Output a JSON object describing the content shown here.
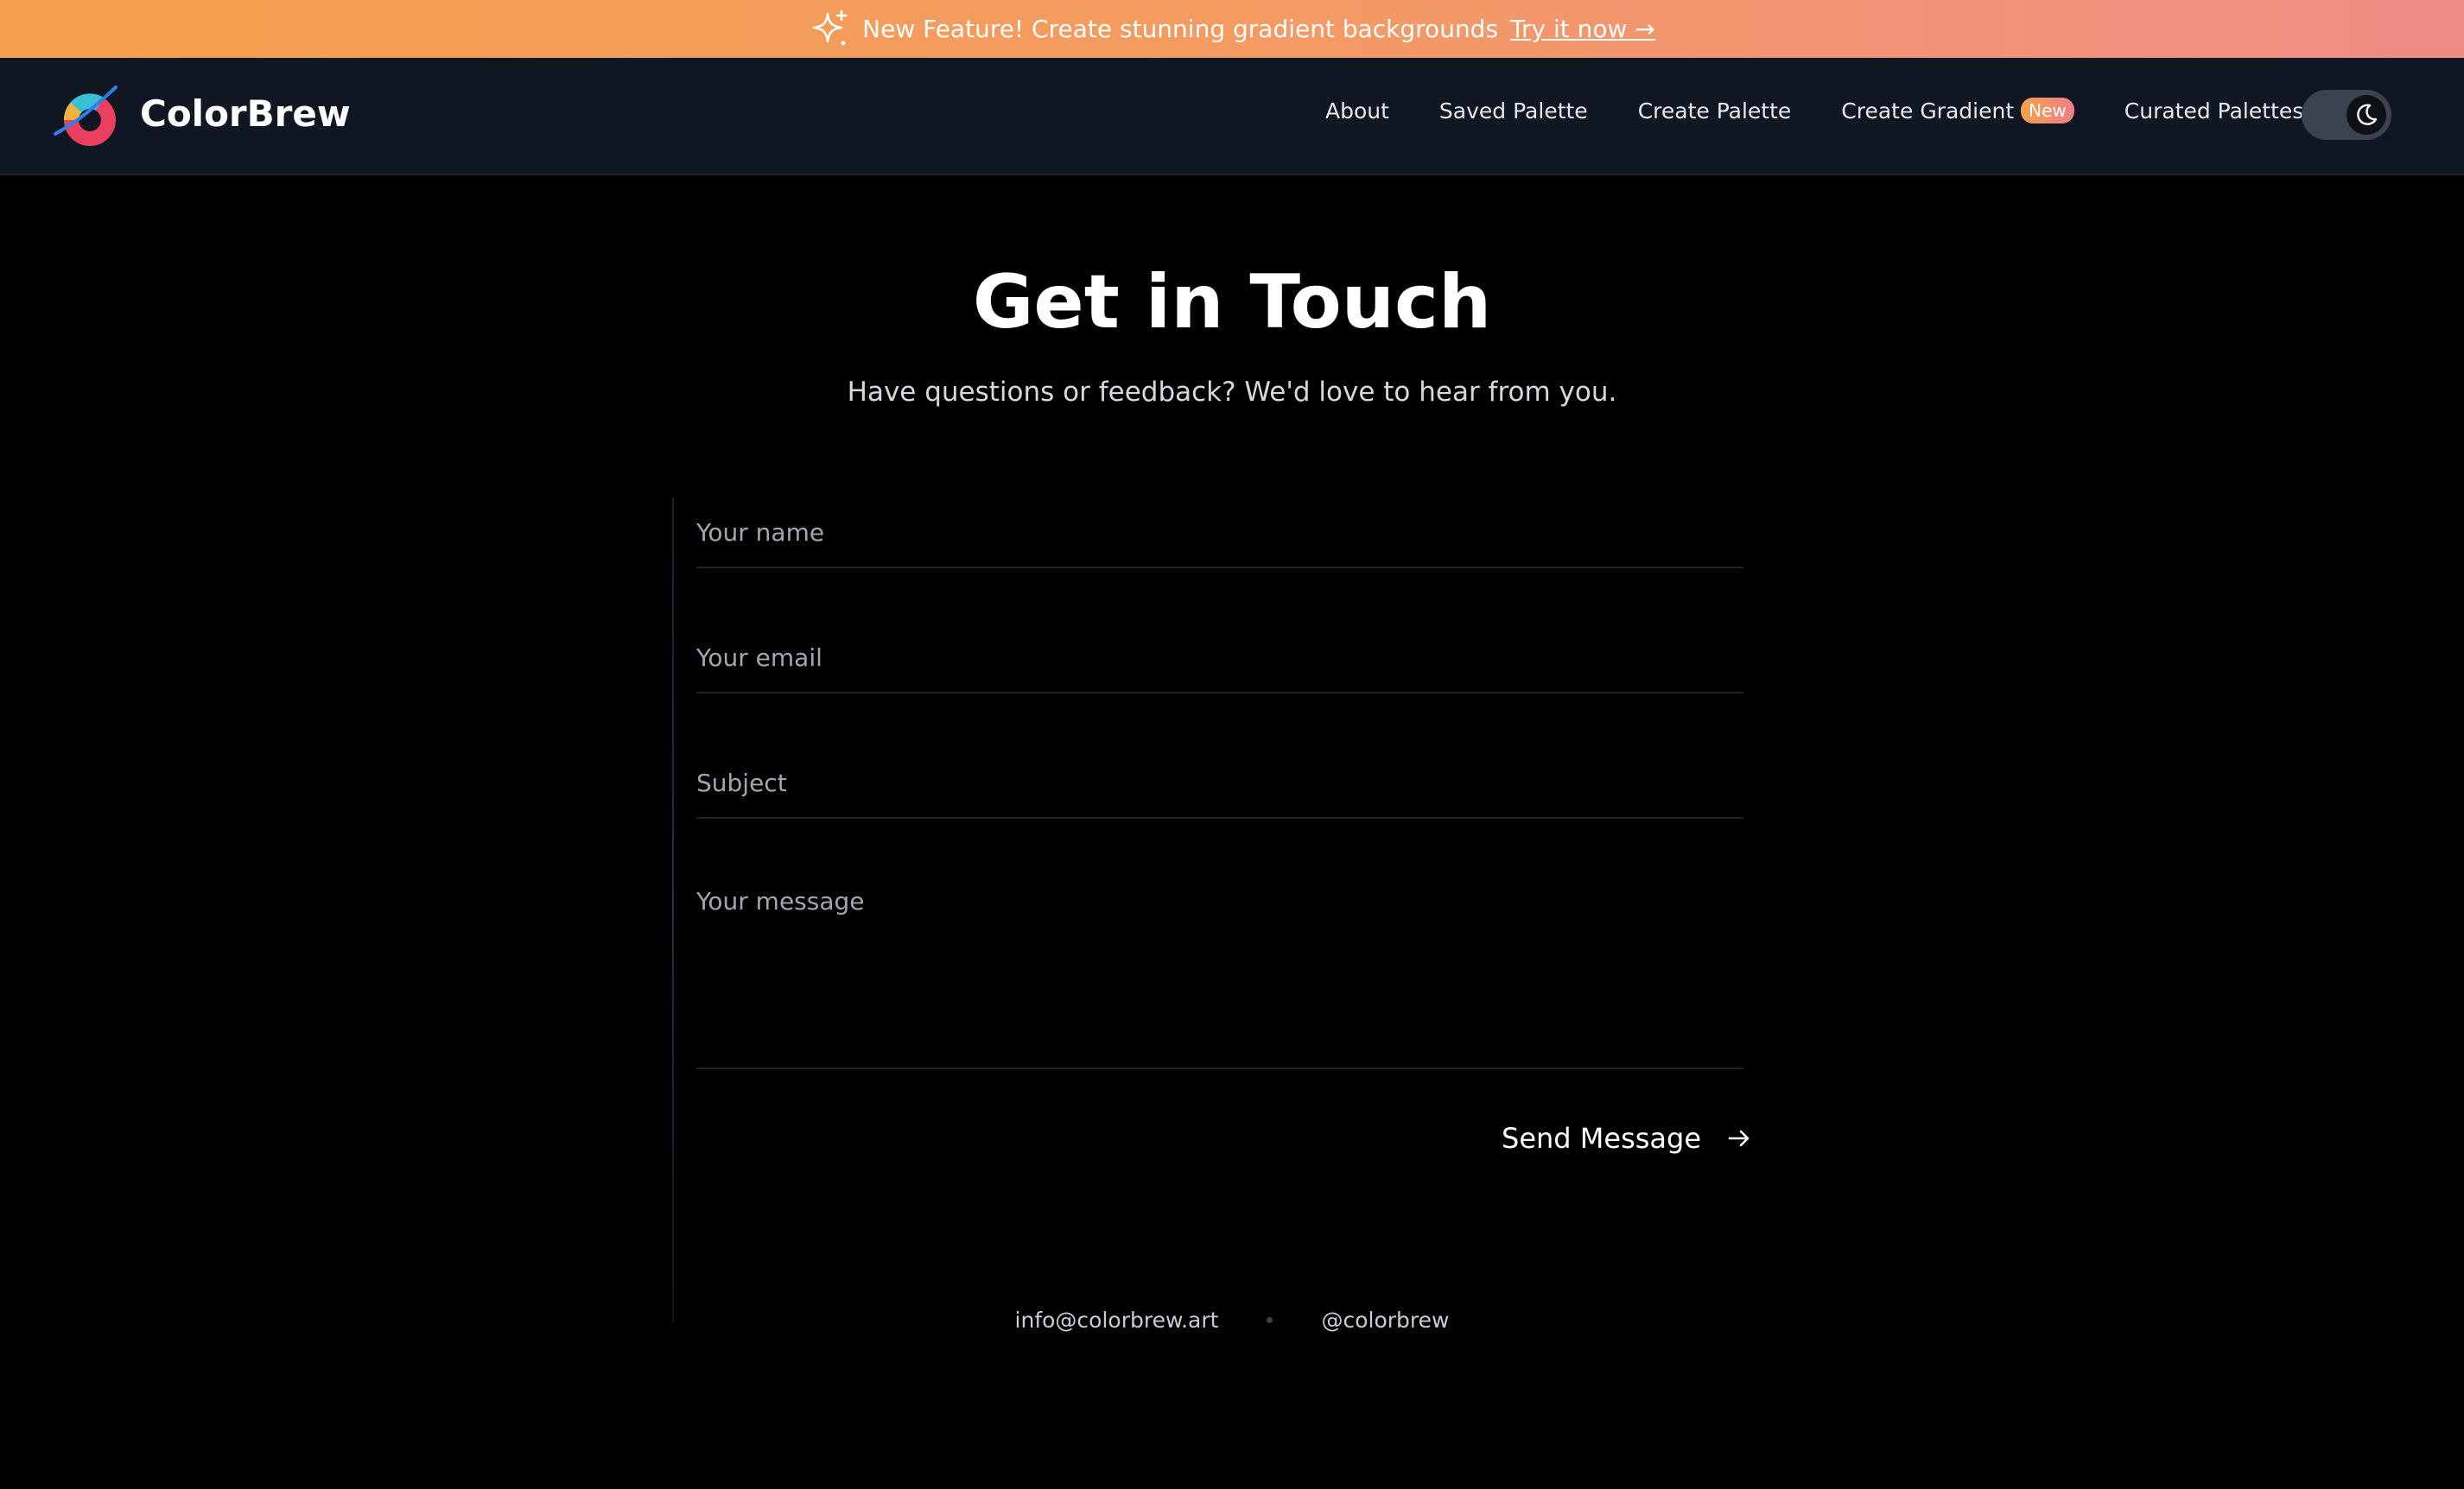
{
  "banner": {
    "icon": "sparkle-icon",
    "text": "New Feature! Create stunning gradient backgrounds",
    "cta": "Try it now →",
    "gradient": [
      "#f4a04c",
      "#ef8c86"
    ]
  },
  "nav": {
    "brand": "ColorBrew",
    "logo": "colorbrew-logo",
    "items": [
      {
        "label": "About"
      },
      {
        "label": "Saved Palette"
      },
      {
        "label": "Create Palette"
      },
      {
        "label": "Create Gradient",
        "badge": "New"
      },
      {
        "label": "Curated Palettes"
      }
    ],
    "theme_toggle": {
      "state": "dark",
      "icon": "moon-icon"
    }
  },
  "main": {
    "title": "Get in Touch",
    "subtitle": "Have questions or feedback? We'd love to hear from you.",
    "form": {
      "name_placeholder": "Your name",
      "name_value": "",
      "email_placeholder": "Your email",
      "email_value": "",
      "subject_placeholder": "Subject",
      "subject_value": "",
      "message_placeholder": "Your message",
      "message_value": "",
      "submit_label": "Send Message",
      "submit_icon": "arrow-right-icon"
    }
  },
  "contacts": {
    "email": "info@colorbrew.art",
    "handle": "@colorbrew"
  },
  "colors": {
    "background": "#000000",
    "nav_background": "#111722",
    "accent_orange": "#f4a04c",
    "accent_pink": "#ef8c86"
  }
}
